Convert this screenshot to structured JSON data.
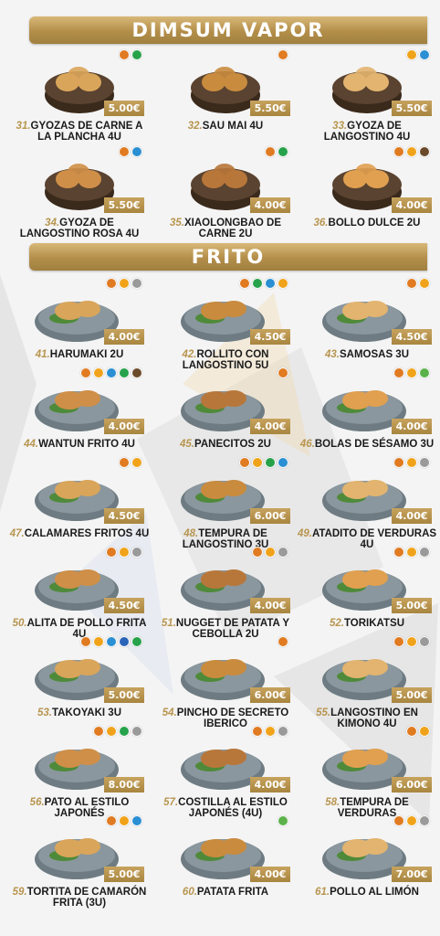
{
  "sections": {
    "dimsum": {
      "title": "DIMSUM VAPOR"
    },
    "frito": {
      "title": "FRITO"
    }
  },
  "accent_color": "#b38e4a",
  "items": [
    {
      "num": "31.",
      "name": "GYOZAS DE CARNE A LA PLANCHA 4U",
      "price": "5.00€",
      "allergens": [
        "gluten",
        "soy"
      ]
    },
    {
      "num": "32.",
      "name": "SAU MAI 4U",
      "price": "5.50€",
      "allergens": [
        "gluten"
      ]
    },
    {
      "num": "33.",
      "name": "GYOZA DE LANGOSTINO 4U",
      "price": "5.50€",
      "allergens": [
        "egg",
        "crust"
      ]
    },
    {
      "num": "34.",
      "name": "GYOZA DE LANGOSTINO ROSA 4U",
      "price": "5.50€",
      "allergens": [
        "gluten",
        "crust"
      ]
    },
    {
      "num": "35.",
      "name": "XIAOLONGBAO DE CARNE 2U",
      "price": "4.00€",
      "allergens": [
        "gluten",
        "soy"
      ]
    },
    {
      "num": "36.",
      "name": "BOLLO DULCE 2U",
      "price": "4.00€",
      "allergens": [
        "gluten",
        "egg",
        "milk"
      ]
    },
    {
      "num": "41.",
      "name": "HARUMAKI 2U",
      "price": "4.00€",
      "allergens": [
        "gluten",
        "egg",
        "sesame"
      ]
    },
    {
      "num": "42.",
      "name": "ROLLITO CON LANGOSTINO 5U",
      "price": "4.50€",
      "allergens": [
        "gluten",
        "soy",
        "crust",
        "egg"
      ]
    },
    {
      "num": "43.",
      "name": "SAMOSAS 3U",
      "price": "4.50€",
      "allergens": [
        "gluten",
        "egg"
      ]
    },
    {
      "num": "44.",
      "name": "WANTUN FRITO 4U",
      "price": "4.00€",
      "allergens": [
        "gluten",
        "egg",
        "crust",
        "soy",
        "milk"
      ]
    },
    {
      "num": "45.",
      "name": "PANECITOS 2U",
      "price": "4.00€",
      "allergens": [
        "gluten"
      ]
    },
    {
      "num": "46.",
      "name": "BOLAS DE SÉSAMO 3U",
      "price": "4.00€",
      "allergens": [
        "gluten",
        "egg",
        "sulfite"
      ]
    },
    {
      "num": "47.",
      "name": "CALAMARES FRITOS 4U",
      "price": "4.50€",
      "allergens": [
        "gluten",
        "egg"
      ]
    },
    {
      "num": "48.",
      "name": "TEMPURA DE LANGOSTINO 3U",
      "price": "6.00€",
      "allergens": [
        "gluten",
        "egg",
        "soy",
        "crust"
      ]
    },
    {
      "num": "49.",
      "name": "ATADITO DE VERDURAS 4U",
      "price": "4.00€",
      "allergens": [
        "gluten",
        "egg",
        "sesame"
      ]
    },
    {
      "num": "50.",
      "name": "ALITA DE POLLO FRITA 4U",
      "price": "4.50€",
      "allergens": [
        "gluten",
        "egg",
        "sesame"
      ]
    },
    {
      "num": "51.",
      "name": "NUGGET DE PATATA Y CEBOLLA 2U",
      "price": "4.00€",
      "allergens": [
        "gluten",
        "egg",
        "sesame"
      ]
    },
    {
      "num": "52.",
      "name": "TORIKATSU",
      "price": "5.00€",
      "allergens": [
        "gluten",
        "egg",
        "sesame"
      ]
    },
    {
      "num": "53.",
      "name": "TAKOYAKI 3U",
      "price": "5.00€",
      "allergens": [
        "gluten",
        "egg",
        "crust",
        "fish",
        "soy"
      ]
    },
    {
      "num": "54.",
      "name": "PINCHO DE SECRETO IBERICO",
      "price": "6.00€",
      "allergens": [
        "gluten"
      ]
    },
    {
      "num": "55.",
      "name": "LANGOSTINO EN KIMONO 4U",
      "price": "5.00€",
      "allergens": [
        "gluten",
        "egg",
        "sesame"
      ]
    },
    {
      "num": "56.",
      "name": "PATO AL ESTILO JAPONÉS",
      "price": "8.00€",
      "allergens": [
        "gluten",
        "egg",
        "soy",
        "sesame"
      ]
    },
    {
      "num": "57.",
      "name": "COSTILLA AL ESTILO JAPONÉS (4U)",
      "price": "4.00€",
      "allergens": [
        "gluten",
        "egg",
        "sesame"
      ]
    },
    {
      "num": "58.",
      "name": "TEMPURA DE VERDURAS",
      "price": "6.00€",
      "allergens": [
        "gluten",
        "egg"
      ]
    },
    {
      "num": "59.",
      "name": "TORTITA DE CAMARÓN FRITA (3U)",
      "price": "5.00€",
      "allergens": [
        "gluten",
        "egg",
        "crust"
      ]
    },
    {
      "num": "60.",
      "name": "PATATA FRITA",
      "price": "4.00€",
      "allergens": [
        "sulfite"
      ]
    },
    {
      "num": "61.",
      "name": "POLLO AL LIMÓN",
      "price": "7.00€",
      "allergens": [
        "gluten",
        "egg",
        "sesame"
      ]
    }
  ]
}
